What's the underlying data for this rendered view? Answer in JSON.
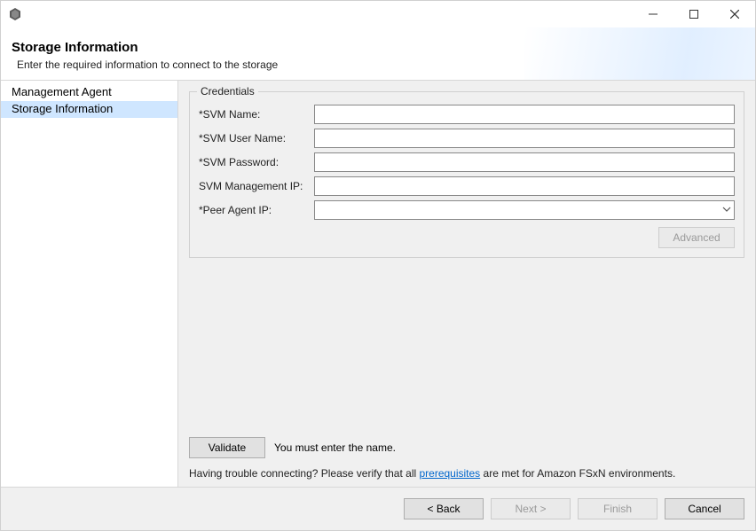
{
  "titlebar": {
    "icon": "hex"
  },
  "header": {
    "title": "Storage Information",
    "subtitle": "Enter the required information to connect to the storage"
  },
  "sidebar": {
    "items": [
      {
        "label": "Management Agent",
        "selected": false
      },
      {
        "label": "Storage Information",
        "selected": true
      }
    ]
  },
  "credentials": {
    "legend": "Credentials",
    "rows": {
      "svm_name": {
        "label": "*SVM Name:",
        "value": ""
      },
      "svm_user": {
        "label": "*SVM User Name:",
        "value": ""
      },
      "svm_password": {
        "label": "*SVM Password:",
        "value": ""
      },
      "svm_mgmt_ip": {
        "label": "SVM Management IP:",
        "value": ""
      },
      "peer_agent_ip": {
        "label": "*Peer Agent IP:",
        "value": ""
      }
    },
    "advanced_label": "Advanced"
  },
  "validate": {
    "button_label": "Validate",
    "message": "You must enter the name."
  },
  "help": {
    "prefix": "Having trouble connecting? Please verify that all ",
    "link_text": "prerequisites",
    "suffix": " are met for Amazon FSxN environments."
  },
  "footer": {
    "back": "< Back",
    "next": "Next >",
    "finish": "Finish",
    "cancel": "Cancel"
  }
}
